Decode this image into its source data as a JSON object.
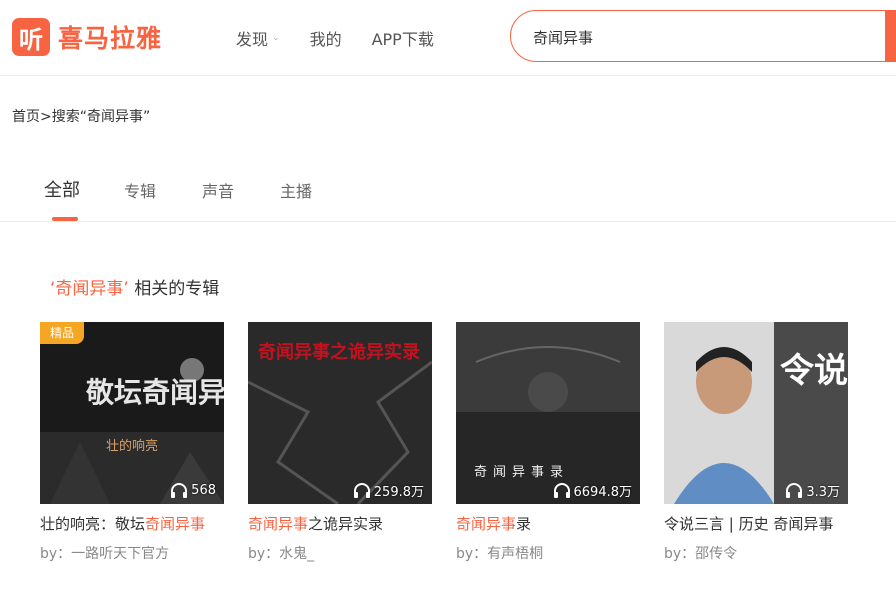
{
  "header": {
    "logo_mark": "听",
    "logo_text": "喜马拉雅",
    "nav": [
      {
        "label": "发现",
        "caret": "⌄"
      },
      {
        "label": "我的"
      },
      {
        "label": "APP下载"
      }
    ],
    "search": {
      "value": "奇闻异事"
    }
  },
  "breadcrumb": "首页>搜索“奇闻异事”",
  "tabs": [
    {
      "label": "全部",
      "active": true
    },
    {
      "label": "专辑"
    },
    {
      "label": "声音"
    },
    {
      "label": "主播"
    }
  ],
  "section": {
    "quote_open": "‘",
    "keyword": "奇闻异事",
    "quote_close": "’",
    "suffix": " 相关的专辑"
  },
  "albums": [
    {
      "badge": "精品",
      "cover_text": "敬坛奇闻异事",
      "cover_sub": "壮的响亮",
      "plays": "568",
      "title_pre": "壮的响亮：敬坛",
      "title_hl": "奇闻异事",
      "title_post": "",
      "author": "by：一路听天下官方"
    },
    {
      "cover_text": "奇闻异事之诡异实录",
      "plays": "259.8万",
      "title_pre": "",
      "title_hl": "奇闻异事",
      "title_post": "之诡异实录",
      "author": "by：水鬼_"
    },
    {
      "cover_text": "奇闻异事录",
      "plays": "6694.8万",
      "title_pre": "",
      "title_hl": "奇闻异事",
      "title_post": "录",
      "author": "by：有声梧桐"
    },
    {
      "cover_text": "令说三言",
      "plays": "3.3万",
      "title_pre": "令说三言 | 历史 奇闻异事",
      "title_hl": "",
      "title_post": "",
      "author": "by：邵传令"
    }
  ],
  "colors": {
    "accent": "#f86442",
    "badge": "#f5a623"
  }
}
